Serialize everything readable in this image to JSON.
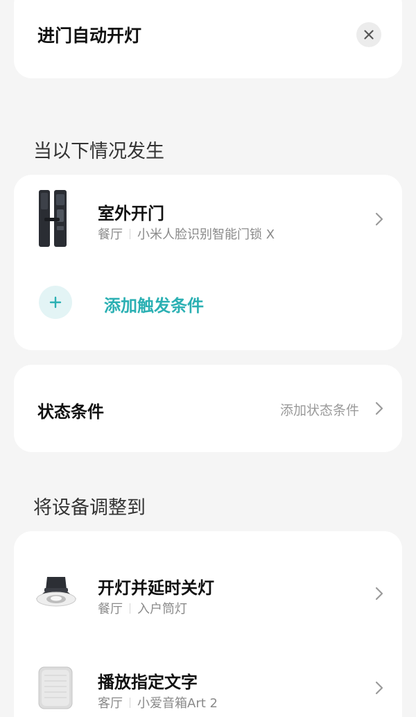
{
  "automation": {
    "title": "进门自动开灯"
  },
  "sections": {
    "trigger_heading": "当以下情况发生",
    "action_heading": "将设备调整到"
  },
  "trigger": {
    "title": "室外开门",
    "room": "餐厅",
    "device": "小米人脸识别智能门锁 X",
    "icon": "door-lock-icon"
  },
  "add_trigger": {
    "label": "添加触发条件"
  },
  "state_condition": {
    "title": "状态条件",
    "action_label": "添加状态条件"
  },
  "actions": [
    {
      "title": "开灯并延时关灯",
      "room": "餐厅",
      "device": "入户筒灯",
      "icon": "downlight-icon"
    },
    {
      "title": "播放指定文字",
      "room": "客厅",
      "device": "小爱音箱Art 2",
      "icon": "speaker-icon"
    }
  ],
  "colors": {
    "accent": "#2bb0b3",
    "background": "#f5f5f5",
    "card": "#ffffff"
  }
}
